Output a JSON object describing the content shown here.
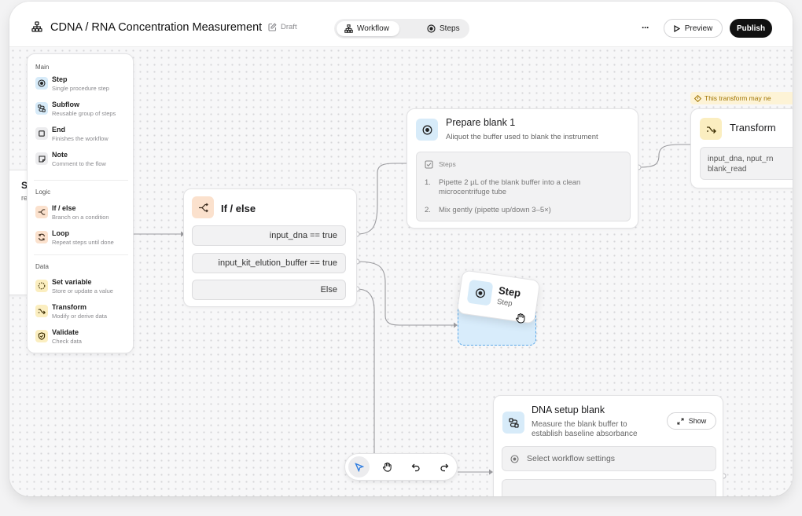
{
  "header": {
    "title": "CDNA / RNA Concentration Measurement",
    "status": "Draft",
    "tabs": [
      {
        "label": "Workflow",
        "active": true
      },
      {
        "label": "Steps",
        "active": false
      }
    ],
    "more_label": "···",
    "preview_label": "Preview",
    "publish_label": "Publish"
  },
  "palette": {
    "sections": [
      {
        "title": "Main",
        "items": [
          {
            "name": "Step",
            "desc": "Single procedure step",
            "icon": "step-icon"
          },
          {
            "name": "Subflow",
            "desc": "Reusable group of steps",
            "icon": "subflow-icon"
          },
          {
            "name": "End",
            "desc": "Finishes the workflow",
            "icon": "end-icon"
          },
          {
            "name": "Note",
            "desc": "Comment to the flow",
            "icon": "note-icon"
          }
        ]
      },
      {
        "title": "Logic",
        "items": [
          {
            "name": "If / else",
            "desc": "Branch on a condition",
            "icon": "branch-icon"
          },
          {
            "name": "Loop",
            "desc": "Repeat steps until done",
            "icon": "loop-icon"
          }
        ]
      },
      {
        "title": "Data",
        "items": [
          {
            "name": "Set variable",
            "desc": "Store or update a value",
            "icon": "variable-icon"
          },
          {
            "name": "Transform",
            "desc": "Modify or derive data",
            "icon": "transform-icon"
          },
          {
            "name": "Validate",
            "desc": "Check data",
            "icon": "validate-icon"
          }
        ]
      }
    ]
  },
  "behind_card": {
    "title_fragment": "S",
    "subtitle_fragment": "re"
  },
  "ifelse": {
    "title": "If / else",
    "conditions": [
      "input_dna == true",
      "input_kit_elution_buffer == true",
      "Else"
    ]
  },
  "prepare": {
    "title": "Prepare blank 1",
    "subtitle": "Aliquot the buffer used to blank the instrument",
    "steps_label": "Steps",
    "steps": [
      {
        "num": "1.",
        "text_line1": "Pipette 2 µL of the blank buffer into a clean",
        "text_line2": "microcentrifuge tube"
      },
      {
        "num": "2.",
        "text_line1": "Mix gently (pipette up/down 3–5×)",
        "text_line2": ""
      }
    ]
  },
  "transform": {
    "warning": "This transform may ne",
    "title": "Transform",
    "io_line1": "input_dna, nput_rn",
    "io_line2": "blank_read"
  },
  "drag_step": {
    "title": "Step",
    "subtitle": "Step"
  },
  "dna_setup": {
    "title": "DNA setup blank",
    "subtitle_line1": "Measure the blank buffer to",
    "subtitle_line2": "establish baseline absorbance",
    "show_label": "Show",
    "settings_placeholder": "Select workflow settings"
  },
  "toolbar": {
    "tools": [
      "select",
      "pan",
      "undo",
      "redo"
    ],
    "active": "select"
  },
  "colors": {
    "accent_blue": "#2f7de0",
    "node_blue": "#d7ebf9",
    "node_peach": "#fbe1cd",
    "node_yellow": "#fbeec0",
    "publish_bg": "#111111",
    "warning": "#a07400"
  }
}
